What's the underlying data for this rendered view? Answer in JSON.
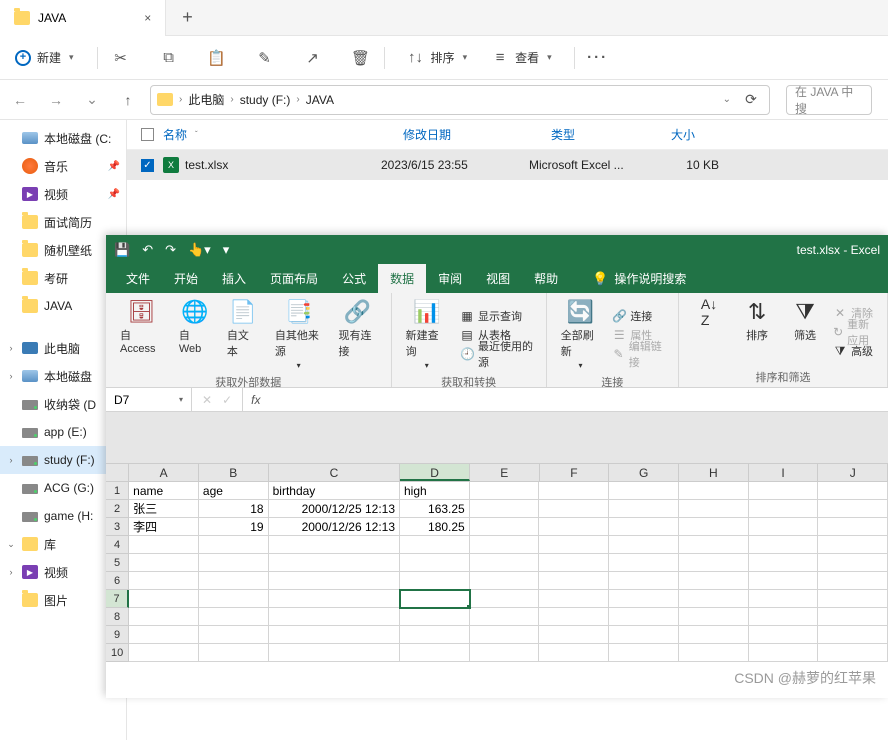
{
  "explorer": {
    "tab_title": "JAVA",
    "new_button": "新建",
    "sort_label": "排序",
    "view_label": "查看",
    "breadcrumb": [
      "此电脑",
      "study (F:)",
      "JAVA"
    ],
    "search_placeholder": "在 JAVA 中搜",
    "columns": {
      "name": "名称",
      "date": "修改日期",
      "type": "类型",
      "size": "大小"
    },
    "file": {
      "name": "test.xlsx",
      "date": "2023/6/15 23:55",
      "type": "Microsoft Excel ...",
      "size": "10 KB"
    },
    "sidebar": {
      "local_disk_c": "本地磁盘 (C:",
      "music": "音乐",
      "video": "视频",
      "resume": "面试简历",
      "wallpaper": "随机壁纸",
      "kaoyan": "考研",
      "java": "JAVA",
      "this_pc": "此电脑",
      "local_disk": "本地磁盘",
      "recycle_d": "收纳袋 (D",
      "app_e": "app (E:)",
      "study_f": "study (F:)",
      "acg_g": "ACG (G:)",
      "game_h": "game (H:",
      "library": "库",
      "lib_video": "视频",
      "lib_pic": "图片"
    }
  },
  "excel": {
    "title": "test.xlsx  -  Excel",
    "tabs": {
      "file": "文件",
      "home": "开始",
      "insert": "插入",
      "layout": "页面布局",
      "formula": "公式",
      "data": "数据",
      "review": "审阅",
      "view": "视图",
      "help": "帮助"
    },
    "tell_me": "操作说明搜索",
    "ribbon": {
      "group1_label": "获取外部数据",
      "from_access": "自 Access",
      "from_web": "自\nWeb",
      "from_text": "自文本",
      "from_other": "自其他来源",
      "existing": "现有连接",
      "group2_label": "获取和转换",
      "new_query": "新建查\n询",
      "show_query": "显示查询",
      "from_table": "从表格",
      "recent": "最近使用的源",
      "group3_label": "连接",
      "refresh_all": "全部刷新",
      "connections": "连接",
      "properties": "属性",
      "edit_links": "编辑链接",
      "group4_label": "排序和筛选",
      "sort": "排序",
      "filter": "筛选",
      "clear": "清除",
      "reapply": "重新应用",
      "advanced": "高级"
    },
    "namebox": "D7",
    "columns": [
      "A",
      "B",
      "C",
      "D",
      "E",
      "F",
      "G",
      "H",
      "I",
      "J"
    ],
    "headers": {
      "A": "name",
      "B": "age",
      "C": "birthday",
      "D": "high"
    }
  },
  "chart_data": {
    "type": "table",
    "columns": [
      "name",
      "age",
      "birthday",
      "high"
    ],
    "rows": [
      {
        "name": "张三",
        "age": 18,
        "birthday": "2000/12/25 12:13",
        "high": 163.25
      },
      {
        "name": "李四",
        "age": 19,
        "birthday": "2000/12/26 12:13",
        "high": 180.25
      }
    ]
  },
  "watermark": "CSDN @赫萝的红苹果"
}
